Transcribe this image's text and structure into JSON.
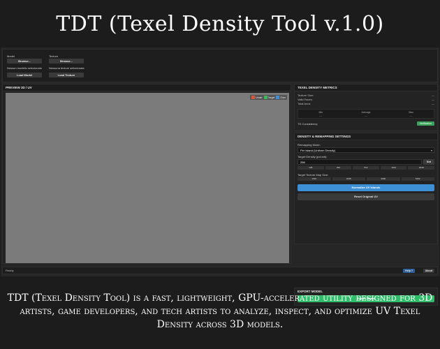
{
  "banner": {
    "title": "TDT (Texel Density Tool v.1.0)",
    "description": "TDT (Texel Density Tool) is a fast, lightweight, GPU-accelerated utility designed for 3D artists, game developers, and tech artists to analyze, inspect, and optimize UV Texel Density across 3D models."
  },
  "load_bar": {
    "model": {
      "label": "Model",
      "browse": "Browse...",
      "status": "Nessun modello selezionato",
      "load": "Load Model"
    },
    "texture": {
      "label": "Texture",
      "browse": "Browse...",
      "status": "Nessuna texture selezionata",
      "load": "Load Texture"
    }
  },
  "preview": {
    "title": "PREVIEW 3D / UV",
    "legend": [
      {
        "label": "Under",
        "color": "#d9553c"
      },
      {
        "label": "Target",
        "color": "#3fb85a"
      },
      {
        "label": "Over",
        "color": "#3d8fd6"
      }
    ]
  },
  "metrics": {
    "title": "TEXEL DENSITY METRICS",
    "rows": [
      {
        "label": "Texture Size:",
        "value": "—"
      },
      {
        "label": "Valid Faces:",
        "value": "—"
      },
      {
        "label": "Total Area:",
        "value": "—"
      }
    ],
    "stats": [
      {
        "label": "Min",
        "value": "—"
      },
      {
        "label": "Average",
        "value": "—"
      },
      {
        "label": "Max",
        "value": "—"
      }
    ],
    "td_consistency_label": "TD Consistency:",
    "td_consistency_badge": "Verification"
  },
  "remap": {
    "title": "DENSITY & REMAPPING SETTINGS",
    "mode_label": "Remapping Mode:",
    "mode_value": "Per Island (Uniform Density)",
    "density_label": "Target Density (px/unit):",
    "density_value": "256",
    "set_label": "Set",
    "density_presets": [
      "128",
      "256",
      "512",
      "1024",
      "2048"
    ],
    "map_size_label": "Target Texture Map Size:",
    "map_presets": [
      "1024",
      "2048",
      "4096",
      "8192"
    ],
    "normalize_label": "Normalize UV Islands",
    "reset_label": "Reset Original UV"
  },
  "export": {
    "title": "EXPORT MODEL",
    "button": "Export Model"
  },
  "status": {
    "text": "Ready",
    "help": "Help ?",
    "about": "About"
  }
}
